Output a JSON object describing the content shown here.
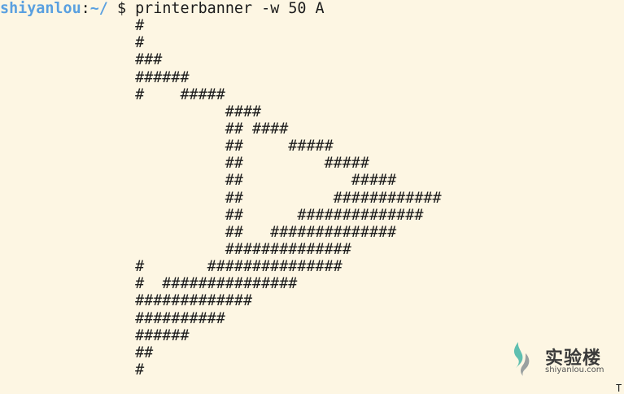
{
  "terminal": {
    "prompt": {
      "user": "shiyanlou",
      "colon": ":",
      "path": "~/",
      "symbol": " $ ",
      "command": "printerbanner -w 50 A"
    },
    "output_lines": [
      "               #",
      "               #",
      "               ###",
      "               ######",
      "               #    #####",
      "                         ####",
      "                         ## ####",
      "                         ##     #####",
      "                         ##         #####",
      "                         ##            #####",
      "                         ##          ############",
      "                         ##      ##############",
      "                         ##   ##############",
      "                         ##############",
      "               #       ###############",
      "               #  ###############",
      "               #############",
      "               ##########",
      "               ######",
      "               ##",
      "               #"
    ]
  },
  "watermark": {
    "name": "实验楼",
    "url": "shiyanlou.com",
    "icon": "shiyanlou-logo-icon",
    "colors": {
      "teal": "#5fbfb0",
      "gray": "#9aa0a0"
    }
  },
  "corner_glyph": "T",
  "colors": {
    "background": "#fdf6e3",
    "prompt": "#5aa0e0",
    "text": "#1c1c1c"
  }
}
